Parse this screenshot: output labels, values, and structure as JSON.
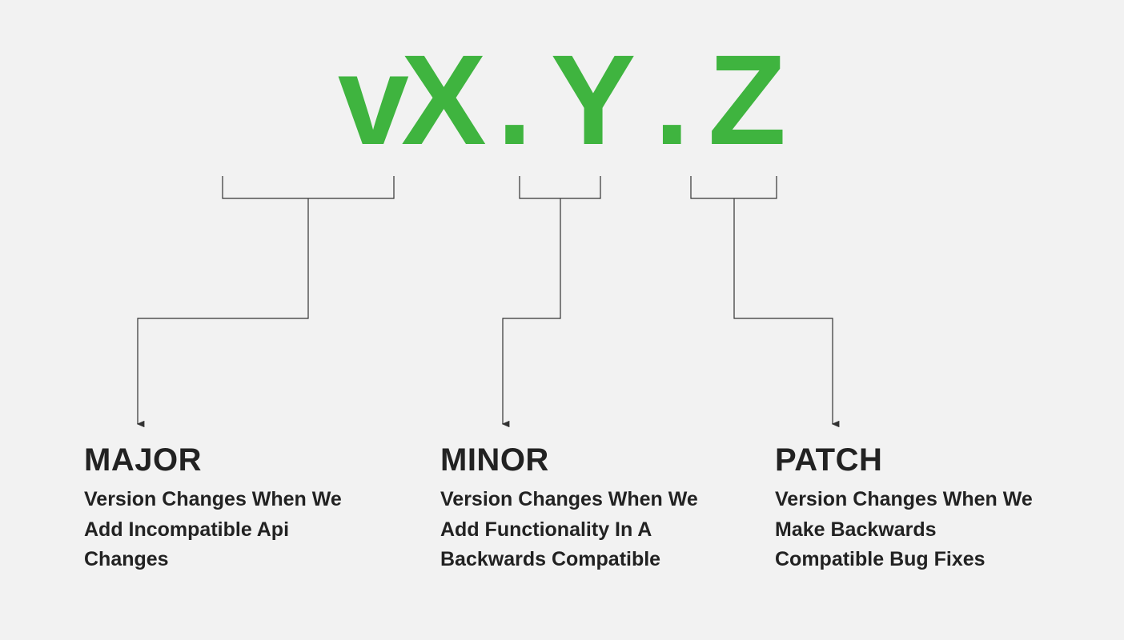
{
  "version_display": {
    "vx": "vX",
    "dot1": ".",
    "y": "Y",
    "dot2": ".",
    "z": "Z"
  },
  "colors": {
    "accent": "#3fb43f",
    "text": "#222222",
    "background": "#f2f2f2",
    "connector": "#333333"
  },
  "sections": {
    "major": {
      "title": "MAJOR",
      "description": "Version Changes When We Add Incompatible Api Changes"
    },
    "minor": {
      "title": "MINOR",
      "description": "Version Changes When We Add Functionality In A Backwards Compatible"
    },
    "patch": {
      "title": "PATCH",
      "description": "Version Changes When We Make Backwards Compatible Bug Fixes"
    }
  }
}
